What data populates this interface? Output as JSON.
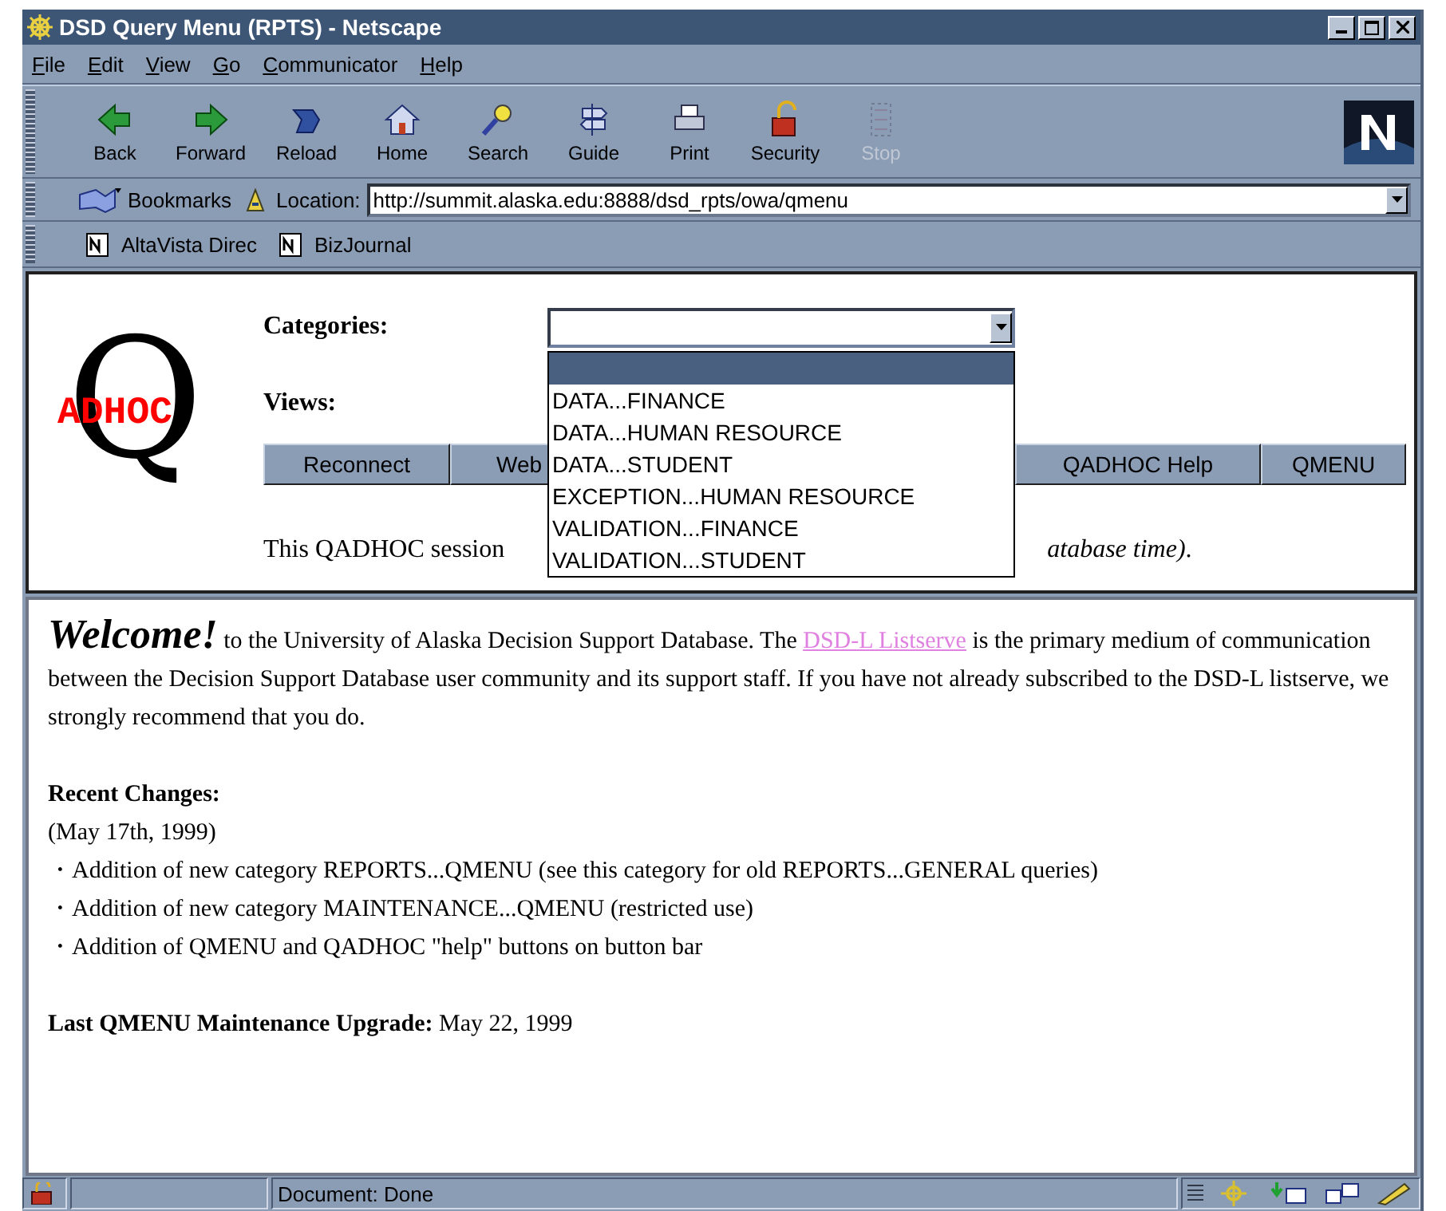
{
  "window": {
    "title": "DSD Query Menu (RPTS) - Netscape"
  },
  "menu": [
    "File",
    "Edit",
    "View",
    "Go",
    "Communicator",
    "Help"
  ],
  "toolbar": [
    {
      "label": "Back",
      "disabled": false
    },
    {
      "label": "Forward",
      "disabled": false
    },
    {
      "label": "Reload",
      "disabled": false
    },
    {
      "label": "Home",
      "disabled": false
    },
    {
      "label": "Search",
      "disabled": false
    },
    {
      "label": "Guide",
      "disabled": false
    },
    {
      "label": "Print",
      "disabled": false
    },
    {
      "label": "Security",
      "disabled": false
    },
    {
      "label": "Stop",
      "disabled": true
    }
  ],
  "location_bar": {
    "bookmarks": "Bookmarks",
    "label": "Location:",
    "url": "http://summit.alaska.edu:8888/dsd_rpts/owa/qmenu"
  },
  "personal_bar": [
    "AltaVista Direc",
    "BizJournal"
  ],
  "query_frame": {
    "logo_letter": "Q",
    "logo_text": "ADHOC",
    "categories_label": "Categories:",
    "views_label": "Views:",
    "options": [
      {
        "selected": true
      },
      {
        "label": "DATA...FINANCE",
        "selected": false
      },
      {
        "label": "DATA...HUMAN RESOURCE",
        "selected": false
      },
      {
        "label": "DATA...STUDENT",
        "selected": false
      },
      {
        "label": "EXCEPTION...HUMAN RESOURCE",
        "selected": false
      },
      {
        "label": "VALIDATION...FINANCE",
        "selected": false
      },
      {
        "label": "VALIDATION...STUDENT",
        "selected": false
      }
    ],
    "buttons": [
      "Reconnect",
      "Web",
      "QADHOC Help",
      "QMENU"
    ],
    "session_start": "This QADHOC session",
    "session_end": "*atabase time)*."
  },
  "content": {
    "welcome": "Welcome!",
    "intro_before": "to the University of Alaska Decision Support Database. The ",
    "link": "DSD-L Listserve",
    "intro_after": " is the primary medium of communication between the Decision Support Database user community and its support staff. If you have not already subscribed to the DSD-L listserve, we strongly recommend that you do.",
    "changes_title": "Recent Changes:",
    "changes_date": "(May 17th, 1999)",
    "changes": [
      "・Addition of new category REPORTS...QMENU (see this category for old REPORTS...GENERAL queries)",
      "・Addition of new category MAINTENANCE...QMENU (restricted use)",
      "・Addition of QMENU and QADHOC \"help\" buttons on button bar"
    ],
    "upgrade": "**Last QMENU Maintenance Upgrade:** May 22, 1999"
  },
  "status_bar": {
    "text": "Document: Done"
  }
}
